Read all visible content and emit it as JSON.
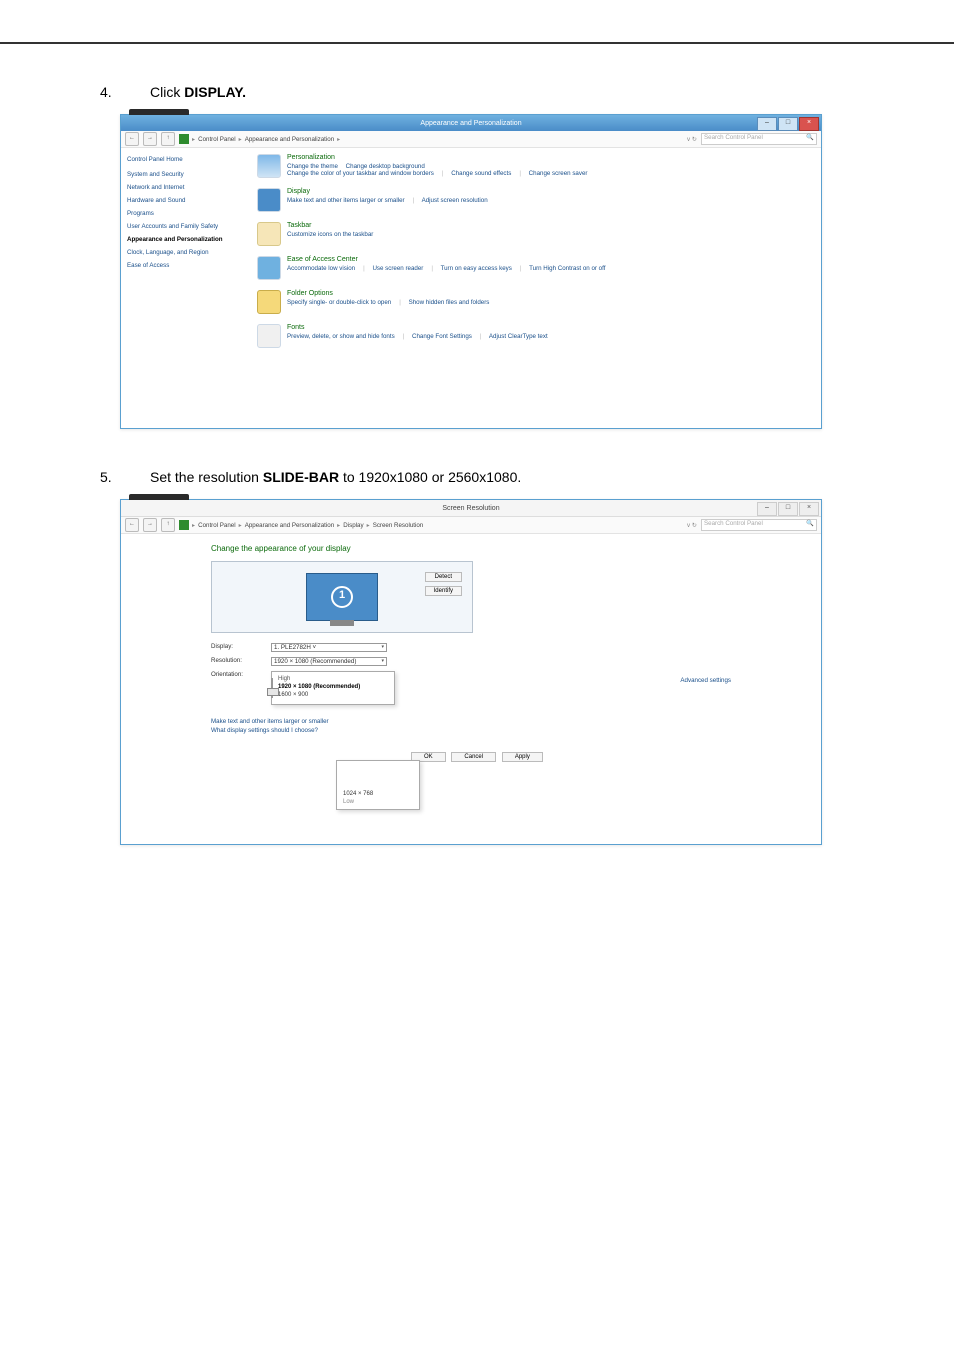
{
  "steps": [
    {
      "num": "4.",
      "prefix": "Click",
      "bold": "DISPLAY."
    },
    {
      "num": "5.",
      "prefix": "Set the resolution",
      "bold": "SLIDE-BAR",
      "suffix": "to 1920x1080 or 2560x1080."
    }
  ],
  "shot1": {
    "title": "Appearance and Personalization",
    "breadcrumb": [
      "Control Panel",
      "Appearance and Personalization"
    ],
    "refresh": "v  ↻",
    "search_placeholder": "Search Control Panel",
    "sidebar": {
      "home": "Control Panel Home",
      "items": [
        "System and Security",
        "Network and Internet",
        "Hardware and Sound",
        "Programs",
        "User Accounts and Family Safety",
        "Appearance and Personalization",
        "Clock, Language, and Region",
        "Ease of Access"
      ]
    },
    "cats": [
      {
        "title": "Personalization",
        "links": [
          "Change the theme",
          "Change desktop background",
          "Change the color of your taskbar and window borders",
          "Change sound effects",
          "Change screen saver"
        ]
      },
      {
        "title": "Display",
        "links": [
          "Make text and other items larger or smaller",
          "Adjust screen resolution"
        ]
      },
      {
        "title": "Taskbar",
        "links": [
          "Customize icons on the taskbar"
        ]
      },
      {
        "title": "Ease of Access Center",
        "links": [
          "Accommodate low vision",
          "Use screen reader",
          "Turn on easy access keys",
          "Turn High Contrast on or off"
        ]
      },
      {
        "title": "Folder Options",
        "links": [
          "Specify single- or double-click to open",
          "Show hidden files and folders"
        ]
      },
      {
        "title": "Fonts",
        "links": [
          "Preview, delete, or show and hide fonts",
          "Change Font Settings",
          "Adjust ClearType text"
        ]
      }
    ]
  },
  "shot2": {
    "title": "Screen Resolution",
    "breadcrumb": [
      "Control Panel",
      "Appearance and Personalization",
      "Display",
      "Screen Resolution"
    ],
    "refresh": "v  ↻",
    "search_placeholder": "Search Control Panel",
    "heading": "Change the appearance of your display",
    "monitor_number": "1",
    "side_buttons": [
      "Detect",
      "Identify"
    ],
    "form": {
      "display_label": "Display:",
      "display_value": "1. PLE2782H  ˅",
      "resolution_label": "Resolution:",
      "resolution_value": "1920 × 1080 (Recommended)",
      "orientation_label": "Orientation:"
    },
    "res_popup": {
      "high": "High",
      "recommended": "1920 × 1080 (Recommended)",
      "mid": "1600 × 900"
    },
    "res_popup2": {
      "value": "1024 × 768",
      "low": "Low"
    },
    "advanced": "Advanced settings",
    "extra_links": [
      "Make text and other items larger or smaller",
      "What display settings should I choose?"
    ],
    "buttons": [
      "OK",
      "Cancel",
      "Apply"
    ]
  }
}
